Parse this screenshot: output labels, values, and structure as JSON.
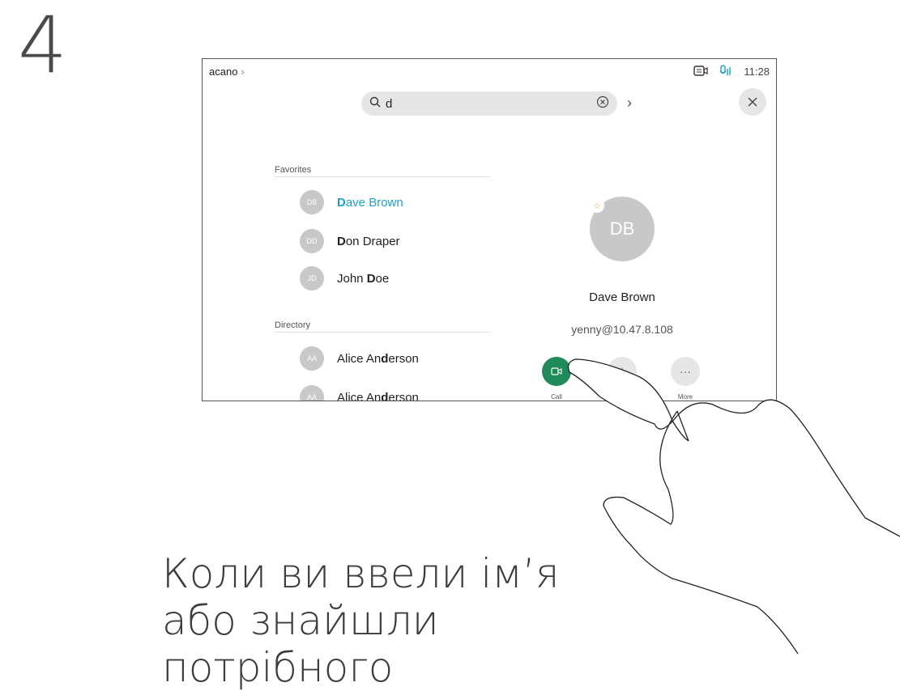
{
  "step": "4",
  "caption": "Коли ви ввели ім’я або знайшли потрібного",
  "screen": {
    "breadcrumb": "acano",
    "time": "11:28",
    "search": {
      "query": "d"
    },
    "favorites": {
      "header": "Favorites",
      "items": [
        {
          "initials": "DB",
          "pre": "",
          "bold": "D",
          "post": "ave Brown",
          "selected": true
        },
        {
          "initials": "DD",
          "pre": "",
          "bold": "D",
          "post": "on Draper",
          "selected": false
        },
        {
          "initials": "JD",
          "pre": "John ",
          "bold": "D",
          "post": "oe",
          "selected": false
        }
      ]
    },
    "directory": {
      "header": "Directory",
      "items": [
        {
          "initials": "AA",
          "pre": "Alice An",
          "bold": "d",
          "post": "erson"
        },
        {
          "initials": "AA",
          "pre": "Alice An",
          "bold": "d",
          "post": "erson"
        }
      ]
    },
    "contact": {
      "initials": "DB",
      "name": "Dave Brown",
      "address": "yenny@10.47.8.108",
      "actions": {
        "call": "Call",
        "more": "More",
        "more_glyph": "···"
      }
    },
    "colors": {
      "accent": "#1ba3c9",
      "call": "#1f8a5a",
      "star": "#f0a830"
    }
  }
}
